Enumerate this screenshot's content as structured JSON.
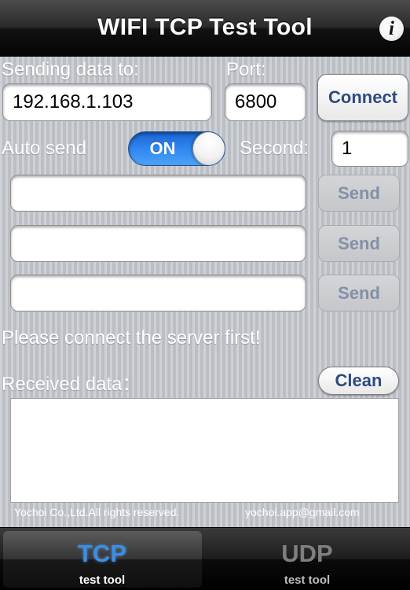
{
  "navbar": {
    "title": "WIFI TCP Test Tool",
    "info_glyph": "i",
    "info_icon": "info-icon"
  },
  "connection": {
    "host_label": "Sending data to:",
    "host_value": "192.168.1.103",
    "port_label": "Port:",
    "port_value": "6800",
    "connect_label": "Connect"
  },
  "auto_send": {
    "label": "Auto send",
    "toggle_state": "ON",
    "toggle_on": true,
    "second_label": "Second:",
    "second_value": "1"
  },
  "send_rows": [
    {
      "value": "",
      "button_label": "Send",
      "enabled": false
    },
    {
      "value": "",
      "button_label": "Send",
      "enabled": false
    },
    {
      "value": "",
      "button_label": "Send",
      "enabled": false
    }
  ],
  "status": {
    "message": "Please connect the server first!"
  },
  "received": {
    "label": "Received data：",
    "clean_label": "Clean",
    "content": ""
  },
  "footer": {
    "copyright": "Yochoi Co.,Ltd.All rights reserved.",
    "email": "yochoi.app@gmail.com"
  },
  "tabs": [
    {
      "icon_text": "TCP",
      "label": "test tool",
      "selected": true
    },
    {
      "icon_text": "UDP",
      "label": "test tool",
      "selected": false
    }
  ],
  "colors": {
    "accent_blue": "#2c4b81",
    "toggle_blue": "#2f87f0",
    "tcp_icon_blue": "#3a8ee6",
    "udp_icon_gray": "#7f7f7f",
    "background_gray": "#c5c8cd"
  }
}
